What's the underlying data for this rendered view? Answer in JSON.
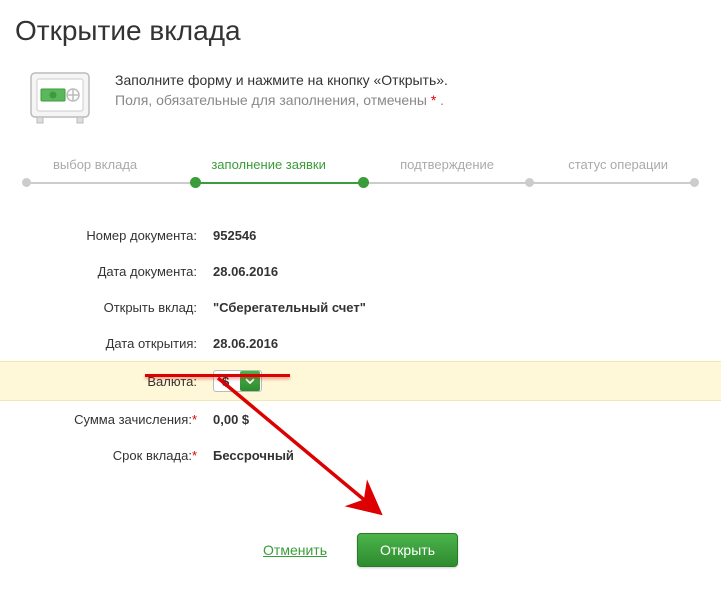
{
  "title": "Открытие вклада",
  "instructions": {
    "line1": "Заполните форму и нажмите на кнопку «Открыть».",
    "line2_a": "Поля, обязательные для заполнения, отмечены ",
    "line2_b": " ."
  },
  "steps": {
    "s1": "выбор вклада",
    "s2": "заполнение заявки",
    "s3": "подтверждение",
    "s4": "статус операции"
  },
  "form": {
    "doc_number_label": "Номер документа:",
    "doc_number_value": "952546",
    "doc_date_label": "Дата документа:",
    "doc_date_value": "28.06.2016",
    "open_deposit_label": "Открыть вклад:",
    "open_deposit_value": "\"Сберегательный счет\"",
    "open_date_label": "Дата открытия:",
    "open_date_value": "28.06.2016",
    "currency_label": "Валюта:",
    "currency_value": "$",
    "amount_label": "Сумма зачисления:",
    "amount_value": "0,00 $",
    "term_label": "Срок вклада:",
    "term_value": "Бессрочный"
  },
  "actions": {
    "cancel": "Отменить",
    "open": "Открыть"
  },
  "required_star": "*"
}
